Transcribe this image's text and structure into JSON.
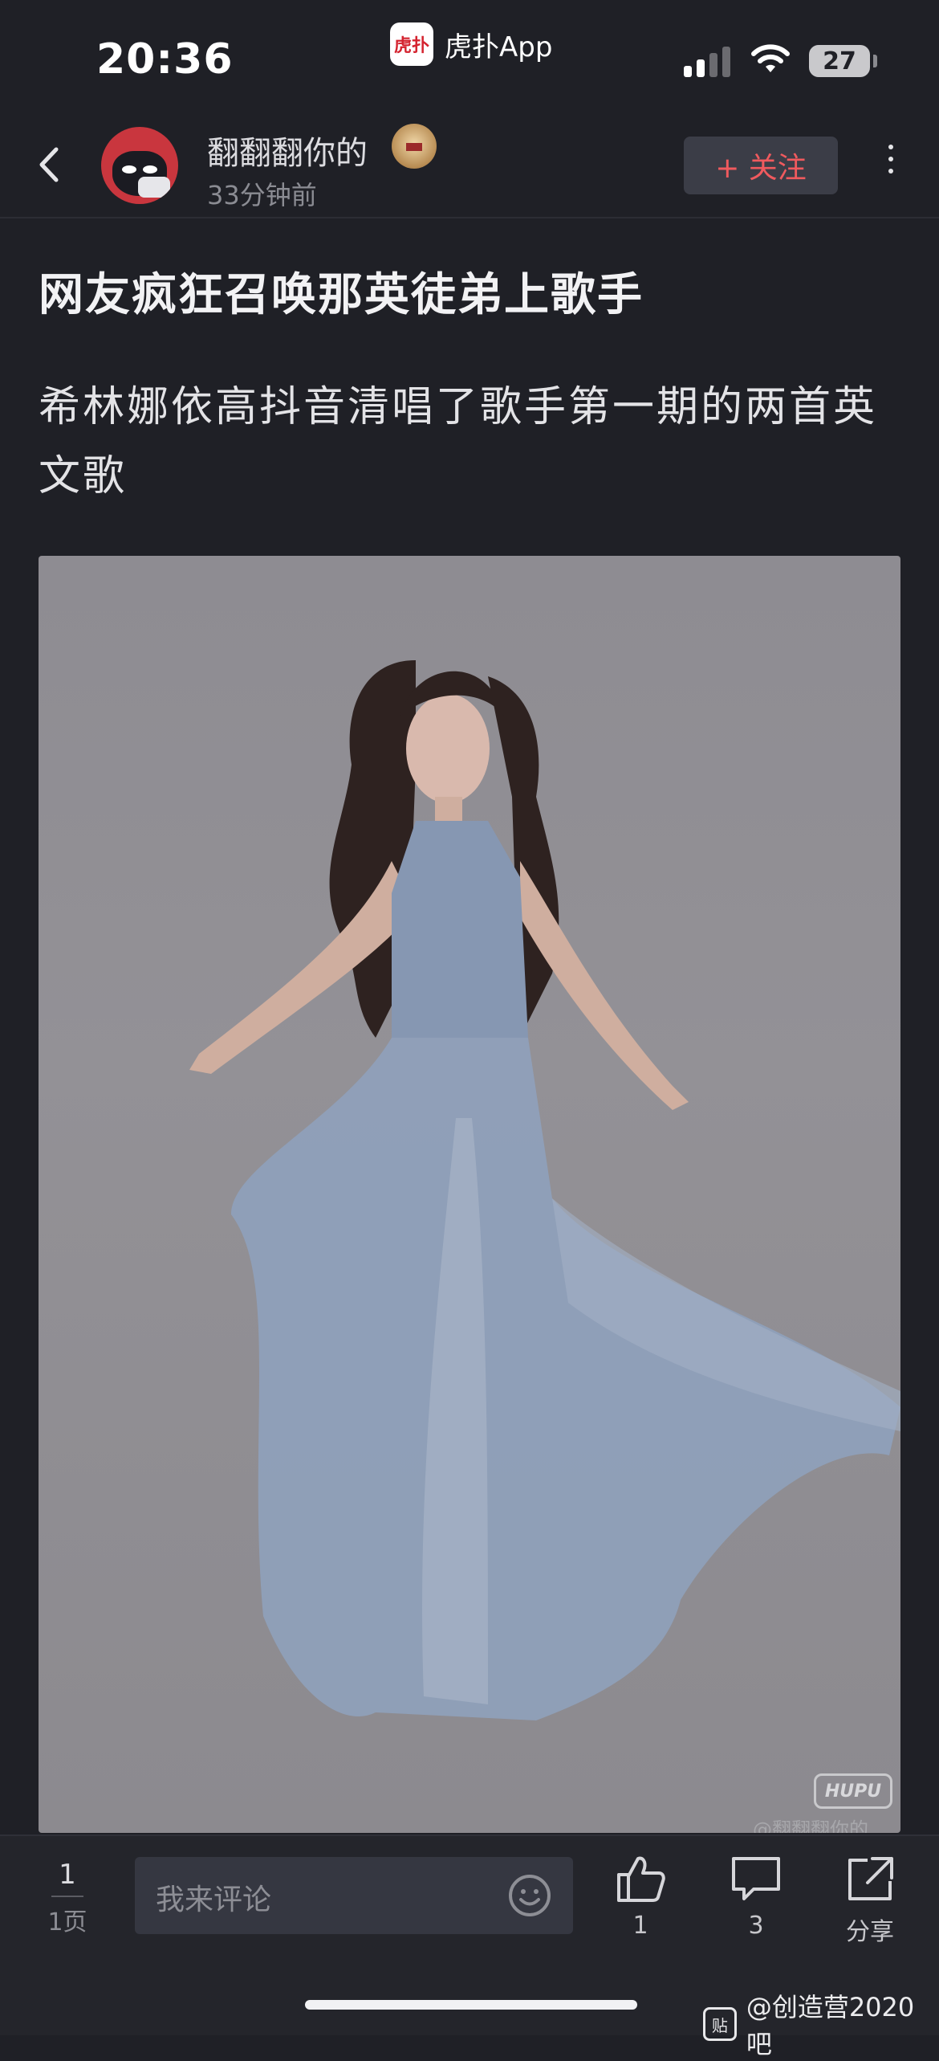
{
  "status": {
    "time": "20:36",
    "app_name": "虎扑App",
    "app_logo_text": "虎扑",
    "battery": "27"
  },
  "header": {
    "username": "翻翻翻你的",
    "post_time": "33分钟前",
    "follow_label": "+ 关注"
  },
  "post": {
    "title": "网友疯狂召唤那英徒弟上歌手",
    "body": "希林娜依高抖音清唱了歌手第一期的两首英文歌",
    "image_watermark_logo": "HUPU",
    "image_watermark_user": "@翻翻翻你的"
  },
  "bottom": {
    "page_current": "1",
    "page_total": "1页",
    "comment_placeholder": "我来评论",
    "like_count": "1",
    "comment_count": "3",
    "share_label": "分享"
  },
  "watermark": {
    "text": "@创造营2020吧",
    "icon_text": "贴"
  },
  "colors": {
    "background": "#1f2026",
    "accent": "#f05a5e",
    "bottom_bar": "#24252b"
  }
}
